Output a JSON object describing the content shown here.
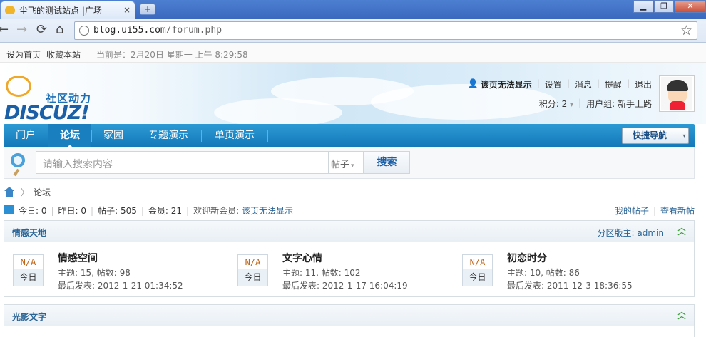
{
  "browser": {
    "tab_title": "尘飞的测试站点 |广场",
    "tab_close": "×",
    "new_tab": "+",
    "url_host": "blog.ui55.com",
    "url_path": "/forum.php",
    "back_icon": "←",
    "forward_icon": "→",
    "reload_icon": "⟳",
    "home_icon": "⌂",
    "star_icon": "☆",
    "win_min": "▁",
    "win_max": "❐",
    "win_close": "✕"
  },
  "topbar": {
    "set_home": "设为首页",
    "bookmark": "收藏本站",
    "current_time": "当前是：2月20日 星期一 上午 8:29:58"
  },
  "header": {
    "logo_cn": "社区动力",
    "logo_en": "DISCUZ!",
    "username": "该页无法显示",
    "settings": "设置",
    "messages": "消息",
    "reminders": "提醒",
    "logout": "退出",
    "credits": "积分: 2",
    "credits_caret": "▾",
    "usergroup": "用户组: 新手上路"
  },
  "mainnav": {
    "items": [
      "门户",
      "论坛",
      "家园",
      "专题演示",
      "单页演示"
    ],
    "active_index": 1,
    "quick_nav": "快捷导航",
    "quick_nav_caret": "▾"
  },
  "search": {
    "placeholder": "请输入搜索内容",
    "type": "帖子",
    "type_caret": "▾",
    "button": "搜索"
  },
  "breadcrumb": {
    "sep": "〉",
    "current": "论坛"
  },
  "stats": {
    "today": "今日: 0",
    "yesterday": "昨日: 0",
    "posts": "帖子: 505",
    "members": "会员: 21",
    "welcome": "欢迎新会员:",
    "new_member": "该页无法显示",
    "my_posts": "我的帖子",
    "view_new": "查看新帖"
  },
  "categories": [
    {
      "title": "情感天地",
      "moderator": "分区版主: admin",
      "forums": [
        {
          "icon_text": "N/A",
          "today_label": "今日",
          "name": "情感空间",
          "meta": "主题: 15, 帖数: 98",
          "last": "最后发表: 2012-1-21 01:34:52"
        },
        {
          "icon_text": "N/A",
          "today_label": "今日",
          "name": "文字心情",
          "meta": "主题: 11, 帖数: 102",
          "last": "最后发表: 2012-1-17 16:04:19"
        },
        {
          "icon_text": "N/A",
          "today_label": "今日",
          "name": "初恋时分",
          "meta": "主题: 10, 帖数: 86",
          "last": "最后发表: 2011-12-3 18:36:55"
        }
      ]
    },
    {
      "title": "光影文字",
      "moderator": "",
      "forums": []
    }
  ],
  "colors": {
    "nav_blue": "#1377b8",
    "link_blue": "#2a6496",
    "collapse_green": "#3d9e3a"
  }
}
